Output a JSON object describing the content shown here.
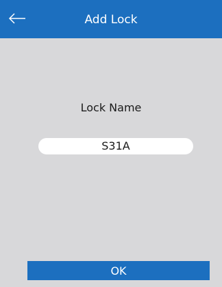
{
  "header": {
    "title": "Add Lock",
    "back_icon": "arrow-left-icon"
  },
  "form": {
    "label": "Lock Name",
    "value": "S31A"
  },
  "actions": {
    "ok_label": "OK"
  },
  "colors": {
    "accent": "#1c6fbf",
    "background": "#d8d8da"
  }
}
